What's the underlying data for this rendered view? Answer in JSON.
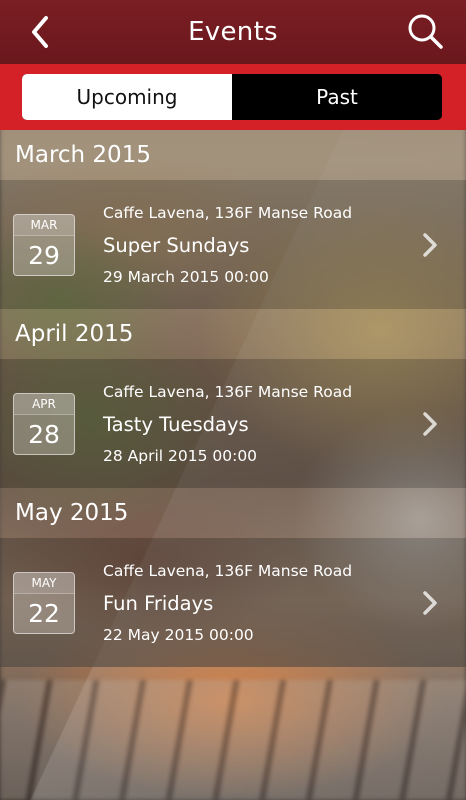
{
  "header": {
    "title": "Events",
    "back_icon": "chevron-left-icon",
    "search_icon": "search-icon"
  },
  "tabs": {
    "upcoming": "Upcoming",
    "past": "Past",
    "active": "upcoming"
  },
  "colors": {
    "header_bg": "#7a1f24",
    "segment_band": "#d42027",
    "active_tab_bg": "#ffffff",
    "inactive_tab_bg": "#000000"
  },
  "sections": [
    {
      "month": "March 2015",
      "events": [
        {
          "cal_month": "MAR",
          "cal_day": "29",
          "venue": "Caffe Lavena, 136F Manse Road",
          "name": "Super Sundays",
          "datetime": "29 March 2015 00:00"
        }
      ]
    },
    {
      "month": "April 2015",
      "events": [
        {
          "cal_month": "APR",
          "cal_day": "28",
          "venue": "Caffe Lavena, 136F Manse Road",
          "name": "Tasty Tuesdays",
          "datetime": "28 April 2015 00:00"
        }
      ]
    },
    {
      "month": "May 2015",
      "events": [
        {
          "cal_month": "MAY",
          "cal_day": "22",
          "venue": "Caffe Lavena, 136F Manse Road",
          "name": "Fun Fridays",
          "datetime": "22 May 2015 00:00"
        }
      ]
    }
  ]
}
